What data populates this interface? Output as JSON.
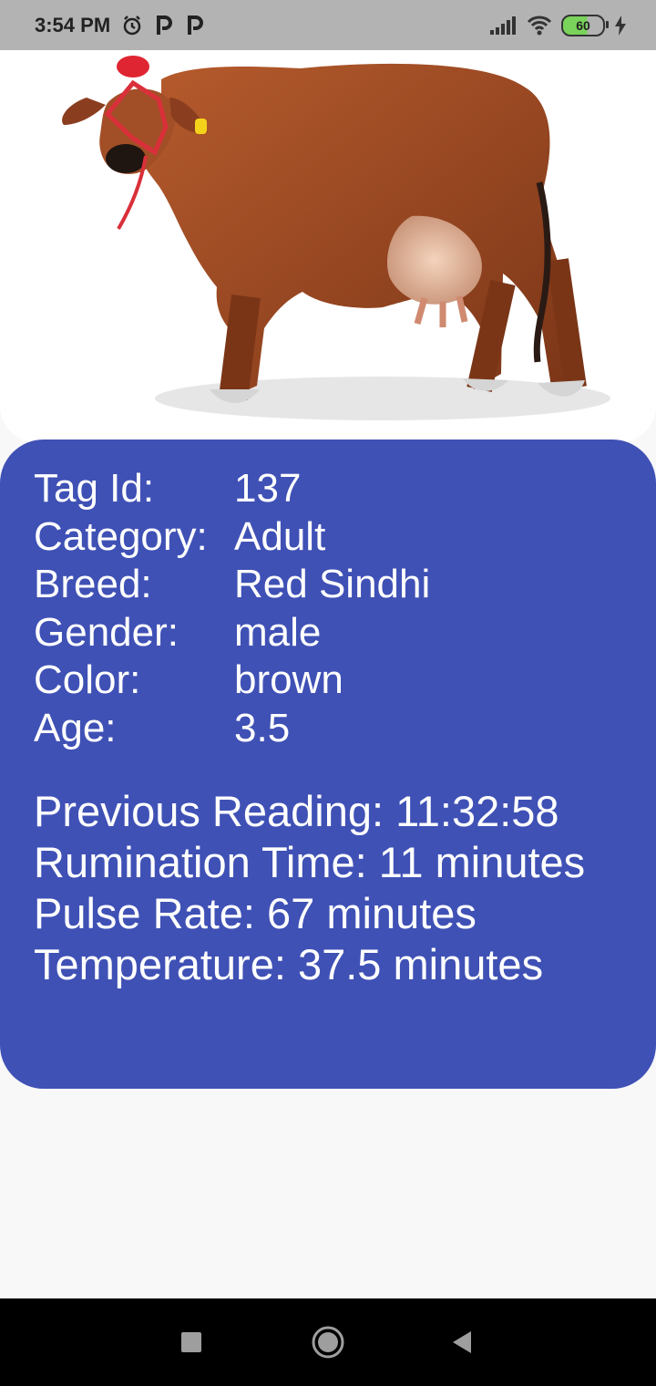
{
  "status_bar": {
    "time": "3:54 PM",
    "battery": "60",
    "icons": [
      "alarm-icon",
      "parking-icon",
      "parking-icon",
      "signal-icon",
      "wifi-icon",
      "battery-icon",
      "charging-icon"
    ]
  },
  "animal": {
    "image_alt": "cow",
    "details": [
      {
        "label": "Tag Id:",
        "value": "137"
      },
      {
        "label": "Category:",
        "value": "Adult"
      },
      {
        "label": "Breed:",
        "value": "Red Sindhi"
      },
      {
        "label": "Gender:",
        "value": "male"
      },
      {
        "label": "Color:",
        "value": "brown"
      },
      {
        "label": "Age:",
        "value": "3.5"
      }
    ],
    "readings": {
      "previous_reading": "Previous Reading: 11:32:58",
      "rumination_time": "Rumination Time: 11 minutes",
      "pulse_rate": "Pulse Rate: 67 minutes",
      "temperature": "Temperature: 37.5 minutes"
    }
  },
  "colors": {
    "card": "#3f51b5",
    "status_bar": "#b3b3b3",
    "cow": "#9a4a25"
  },
  "nav_bar": {
    "icons": [
      "recents-icon",
      "home-icon",
      "back-icon"
    ]
  }
}
